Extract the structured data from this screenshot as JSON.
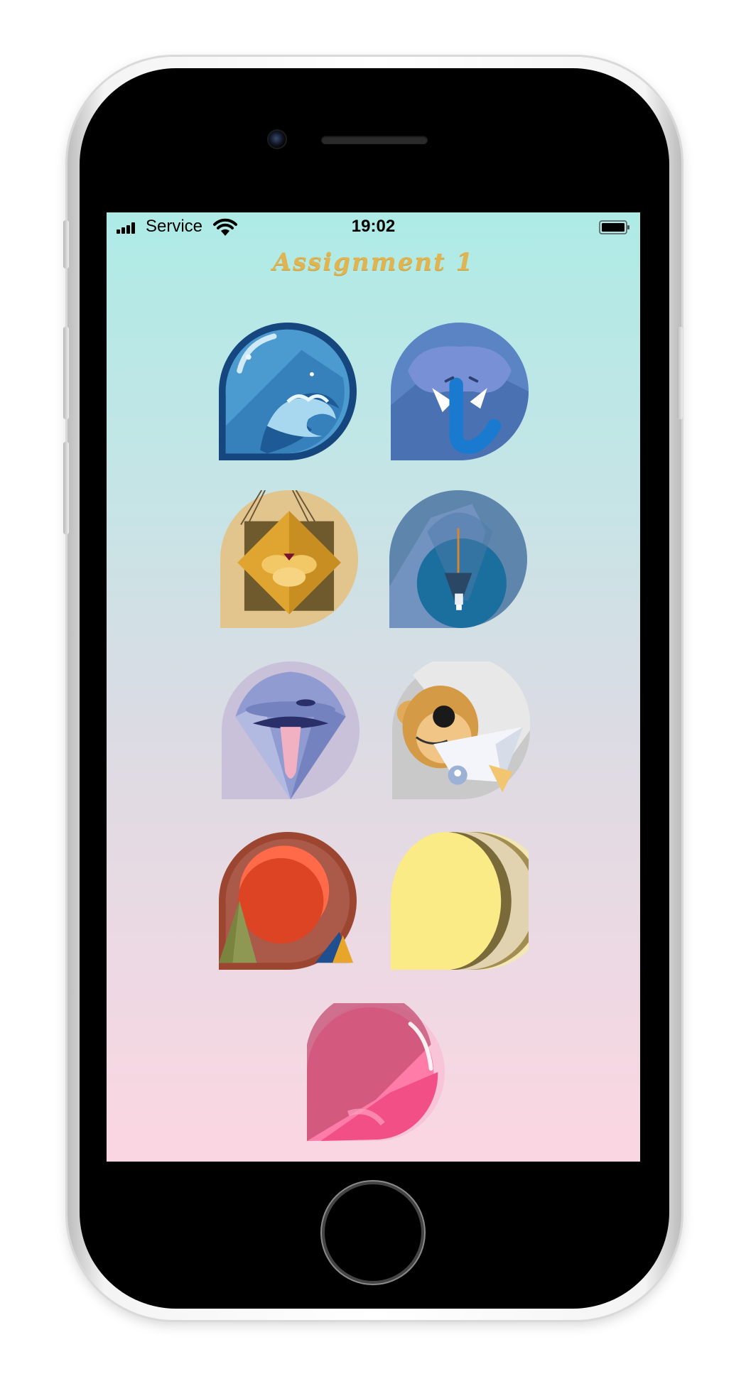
{
  "status_bar": {
    "carrier": "Service",
    "time": "19:02"
  },
  "header": {
    "title": "Assignment 1"
  },
  "icons": [
    {
      "name": "wave-icon"
    },
    {
      "name": "elephant-icon"
    },
    {
      "name": "honey-sign-icon"
    },
    {
      "name": "hot-air-balloon-icon"
    },
    {
      "name": "mouth-icon"
    },
    {
      "name": "monkey-icon"
    },
    {
      "name": "sun-mountains-icon"
    },
    {
      "name": "pages-icon"
    },
    {
      "name": "pink-bubble-icon"
    }
  ]
}
